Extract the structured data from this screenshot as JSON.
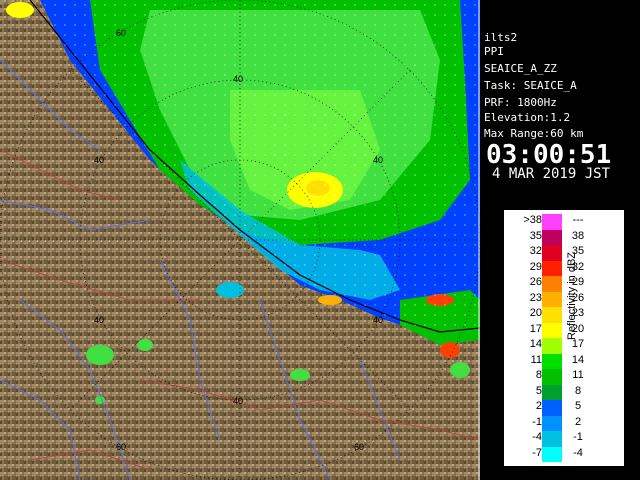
{
  "info": {
    "line1": "ilts2",
    "line2": "PPI",
    "line3": "SEAICE_A_ZZ",
    "line4": "Task: SEAICE_A",
    "line5": "PRF: 1800Hz",
    "line6": "Elevation:1.2",
    "line7": "Max Range:60 km",
    "time": "03:00:51",
    "date": "4 MAR 2019 JST"
  },
  "range_labels": {
    "r40": "40",
    "r60": "60"
  },
  "legend": {
    "unit": "Reflectivity in dBZ",
    "rows": [
      {
        "lo": ">38",
        "hi": "---",
        "color": "#ff40ff"
      },
      {
        "lo": "35",
        "hi": "38",
        "color": "#c00060"
      },
      {
        "lo": "32",
        "hi": "35",
        "color": "#e00020"
      },
      {
        "lo": "29",
        "hi": "32",
        "color": "#ff2000"
      },
      {
        "lo": "26",
        "hi": "29",
        "color": "#ff8000"
      },
      {
        "lo": "23",
        "hi": "26",
        "color": "#ffb000"
      },
      {
        "lo": "20",
        "hi": "23",
        "color": "#ffe000"
      },
      {
        "lo": "17",
        "hi": "20",
        "color": "#ffff00"
      },
      {
        "lo": "14",
        "hi": "17",
        "color": "#a0ff00"
      },
      {
        "lo": "11",
        "hi": "14",
        "color": "#00e000"
      },
      {
        "lo": "8",
        "hi": "11",
        "color": "#00c000"
      },
      {
        "lo": "5",
        "hi": "8",
        "color": "#00a030"
      },
      {
        "lo": "2",
        "hi": "5",
        "color": "#0060ff"
      },
      {
        "lo": "-1",
        "hi": "2",
        "color": "#0090ff"
      },
      {
        "lo": "-4",
        "hi": "-1",
        "color": "#00c0e0"
      },
      {
        "lo": "-7",
        "hi": "-4",
        "color": "#00ffff"
      }
    ]
  }
}
